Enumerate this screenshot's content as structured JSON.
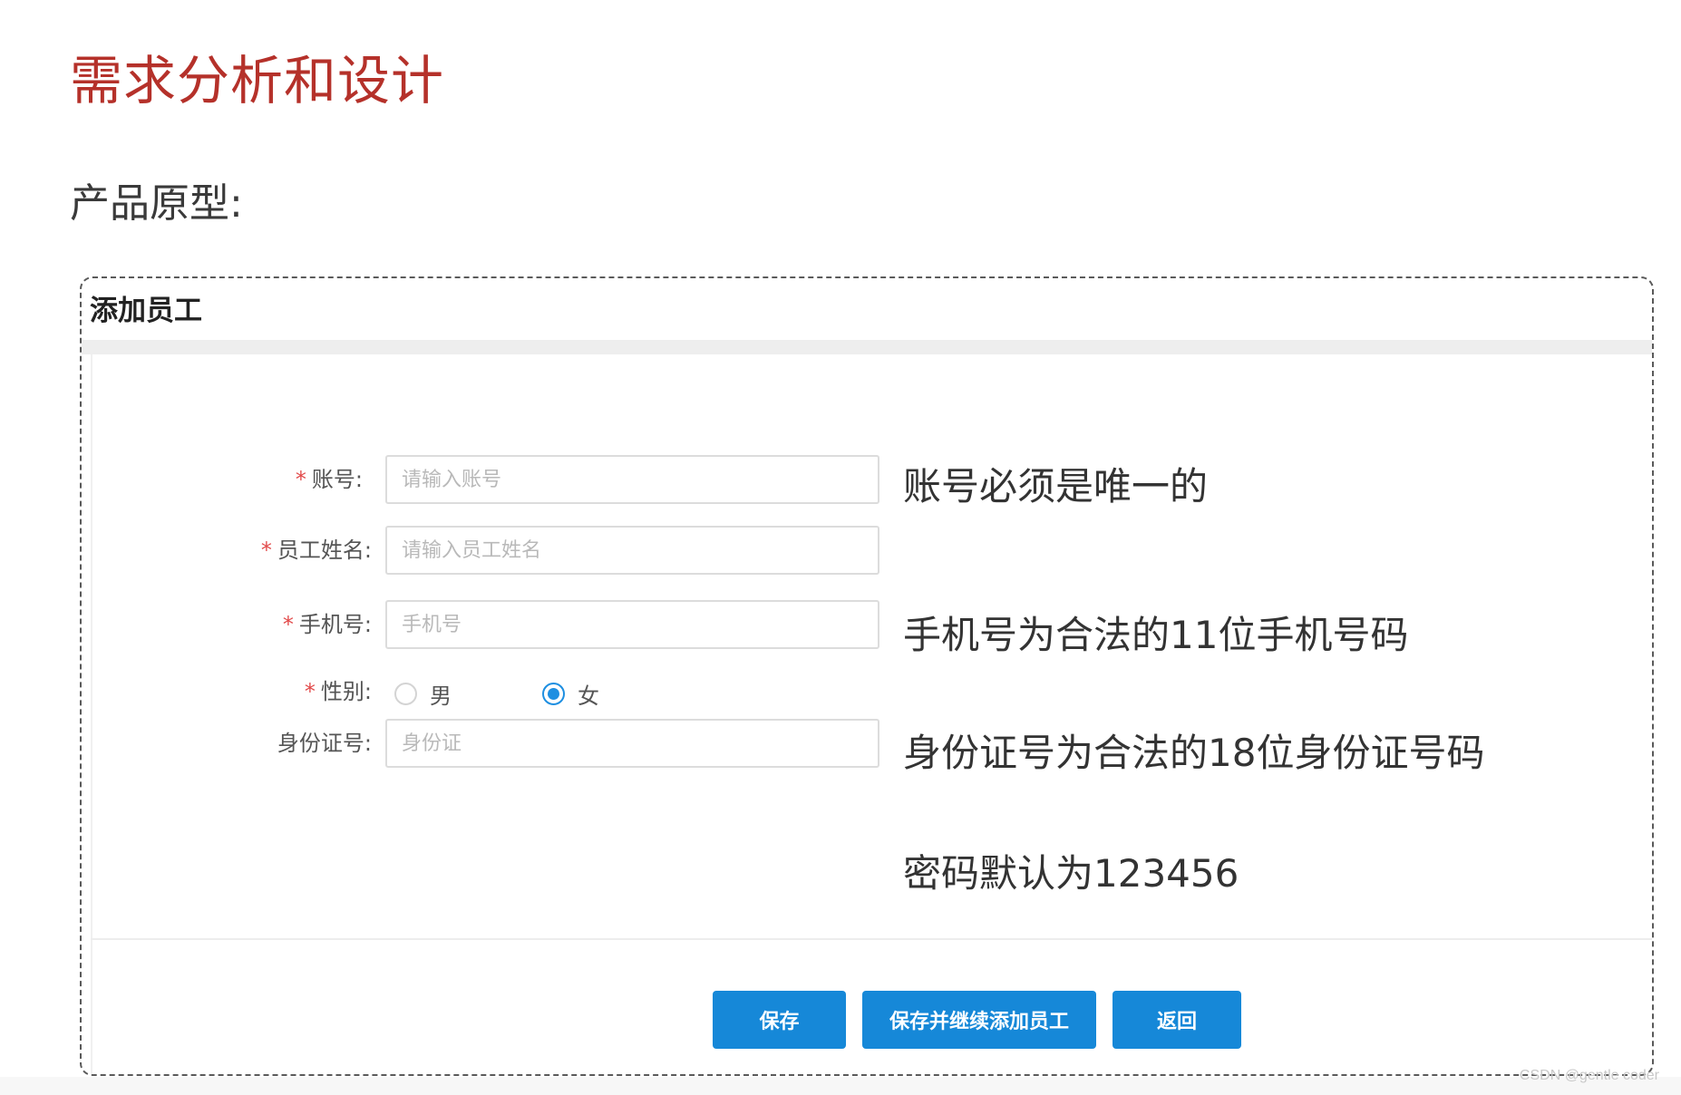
{
  "slide": {
    "title": "需求分析和设计",
    "subtitle": "产品原型:"
  },
  "panel": {
    "title": "添加员工"
  },
  "form": {
    "account": {
      "label": "账号:",
      "required_mark": "*",
      "placeholder": "请输入账号",
      "value": ""
    },
    "name": {
      "label": "员工姓名:",
      "required_mark": "*",
      "placeholder": "请输入员工姓名",
      "value": ""
    },
    "phone": {
      "label": "手机号:",
      "required_mark": "*",
      "placeholder": "手机号",
      "value": ""
    },
    "gender": {
      "label": "性别:",
      "required_mark": "*",
      "options": [
        {
          "label": "男",
          "checked": false
        },
        {
          "label": "女",
          "checked": true
        }
      ],
      "selected": "女"
    },
    "id_card": {
      "label": "身份证号:",
      "placeholder": "身份证",
      "value": ""
    }
  },
  "notes": {
    "account": "账号必须是唯一的",
    "phone": "手机号为合法的11位手机号码",
    "id_card": "身份证号为合法的18位身份证号码",
    "password": "密码默认为123456"
  },
  "buttons": {
    "save": "保存",
    "save_continue": "保存并继续添加员工",
    "back": "返回"
  },
  "colors": {
    "title_red": "#b5312a",
    "button_blue": "#1688d8",
    "required_red": "#e24a4a",
    "radio_blue": "#1e8fe1"
  },
  "icons": {
    "radio_unchecked": "radio-unchecked-icon",
    "radio_checked": "radio-checked-icon"
  },
  "watermark": "CSDN @gentle coder"
}
